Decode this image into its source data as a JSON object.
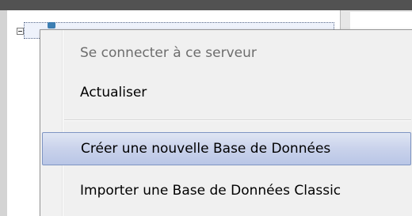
{
  "context_menu": {
    "items": [
      {
        "label": "Se connecter à ce serveur",
        "state": "disabled"
      },
      {
        "label": "Actualiser",
        "state": "normal"
      },
      {
        "label": "Créer une nouvelle Base de Données",
        "state": "highlighted"
      },
      {
        "label": "Importer une Base de Données Classic",
        "state": "normal"
      }
    ]
  },
  "tree": {
    "expander_state": "expanded",
    "node_icon": "server-icon"
  },
  "colors": {
    "highlight": "#c9d2eb",
    "highlight_border": "#7e94c2",
    "menu_background": "#f0f0f0",
    "disabled_text": "#6d6d6d"
  }
}
